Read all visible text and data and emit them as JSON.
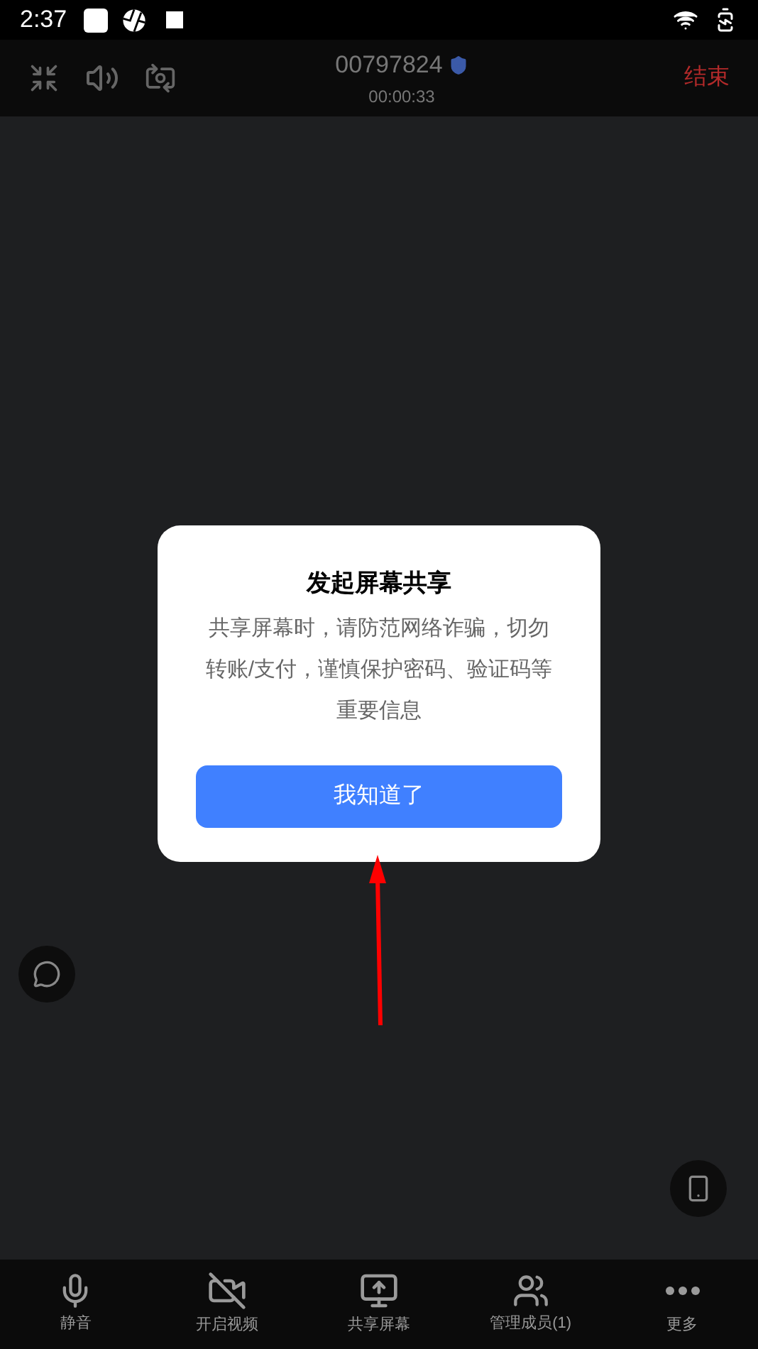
{
  "status_bar": {
    "time": "2:37"
  },
  "call_header": {
    "meeting_id": "00797824",
    "duration": "00:00:33",
    "end_label": "结束"
  },
  "dialog": {
    "title": "发起屏幕共享",
    "message": "共享屏幕时，请防范网络诈骗，切勿转账/支付，谨慎保护密码、验证码等重要信息",
    "button": "我知道了"
  },
  "toolbar": [
    {
      "kind": "mic",
      "label": "静音"
    },
    {
      "kind": "video",
      "label": "开启视频"
    },
    {
      "kind": "share",
      "label": "共享屏幕"
    },
    {
      "kind": "members",
      "label": "管理成员(1)"
    },
    {
      "kind": "more",
      "label": "更多"
    }
  ]
}
